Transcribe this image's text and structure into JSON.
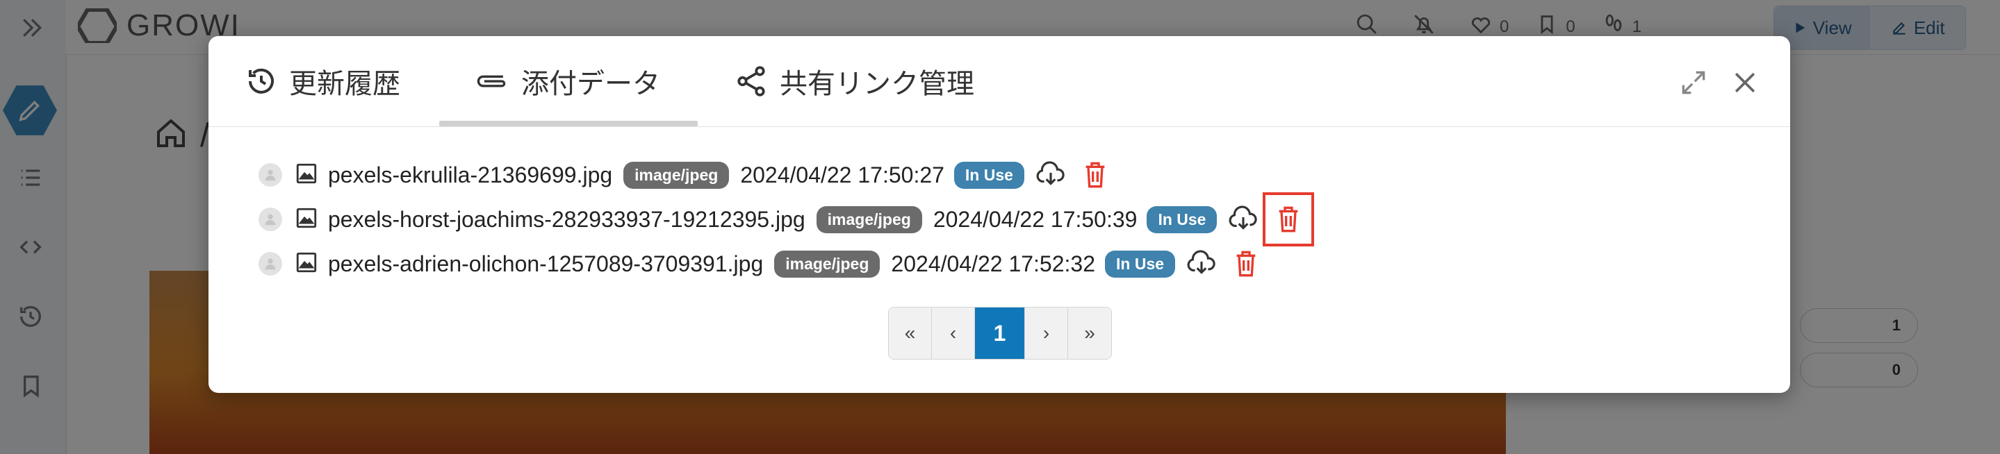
{
  "app": {
    "brand": "GROWI",
    "topbar": {
      "likes": "0",
      "bookmarks": "0",
      "seen": "1"
    },
    "view_label": "View",
    "edit_label": "Edit",
    "page_path_sep": "/",
    "stats": [
      "1",
      "0"
    ]
  },
  "modal": {
    "tabs": [
      {
        "label": "更新履歴",
        "icon": "history-icon"
      },
      {
        "label": "添付データ",
        "icon": "paperclip-icon",
        "active": true
      },
      {
        "label": "共有リンク管理",
        "icon": "share-icon"
      }
    ],
    "attachments": [
      {
        "filename": "pexels-ekrulila-21369699.jpg",
        "mime": "image/jpeg",
        "timestamp": "2024/04/22 17:50:27",
        "status": "In Use"
      },
      {
        "filename": "pexels-horst-joachims-282933937-19212395.jpg",
        "mime": "image/jpeg",
        "timestamp": "2024/04/22 17:50:39",
        "status": "In Use",
        "highlighted_delete": true
      },
      {
        "filename": "pexels-adrien-olichon-1257089-3709391.jpg",
        "mime": "image/jpeg",
        "timestamp": "2024/04/22 17:52:32",
        "status": "In Use"
      }
    ],
    "pagination": {
      "first": "«",
      "prev": "‹",
      "current": "1",
      "next": "›",
      "last": "»"
    }
  },
  "colors": {
    "accent": "#1078b8",
    "danger": "#e63b2e",
    "in_use": "#3e82ad",
    "mime": "#6b6b6b"
  }
}
